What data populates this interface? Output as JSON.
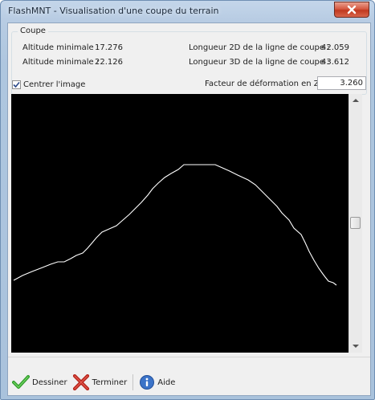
{
  "window": {
    "title": "FlashMNT - Visualisation d'une coupe du terrain"
  },
  "group": {
    "legend": "Coupe",
    "alt_min_label": "Altitude minimale :",
    "alt_min_value": "17.276",
    "alt_max_label": "Altitude minimale :",
    "alt_max_value": "22.126",
    "len2d_label": "Longueur 2D de la ligne de coupe :",
    "len2d_value": "42.059",
    "len3d_label": "Longueur 3D de la ligne de coupe :",
    "len3d_value": "43.612"
  },
  "options": {
    "center_label": "Centrer l'image",
    "center_checked": true,
    "factor_label": "Facteur de déformation en Z :",
    "factor_value": "3.260"
  },
  "profile": {
    "line_color": "#ffffff",
    "background": "#000000",
    "scroll_position": 0.53
  },
  "toolbar": {
    "draw_label": "Dessiner",
    "finish_label": "Terminer",
    "help_label": "Aide"
  },
  "icons": {
    "close": "close-icon",
    "draw": "checkmark-icon",
    "finish": "cross-icon",
    "help": "info-icon"
  }
}
